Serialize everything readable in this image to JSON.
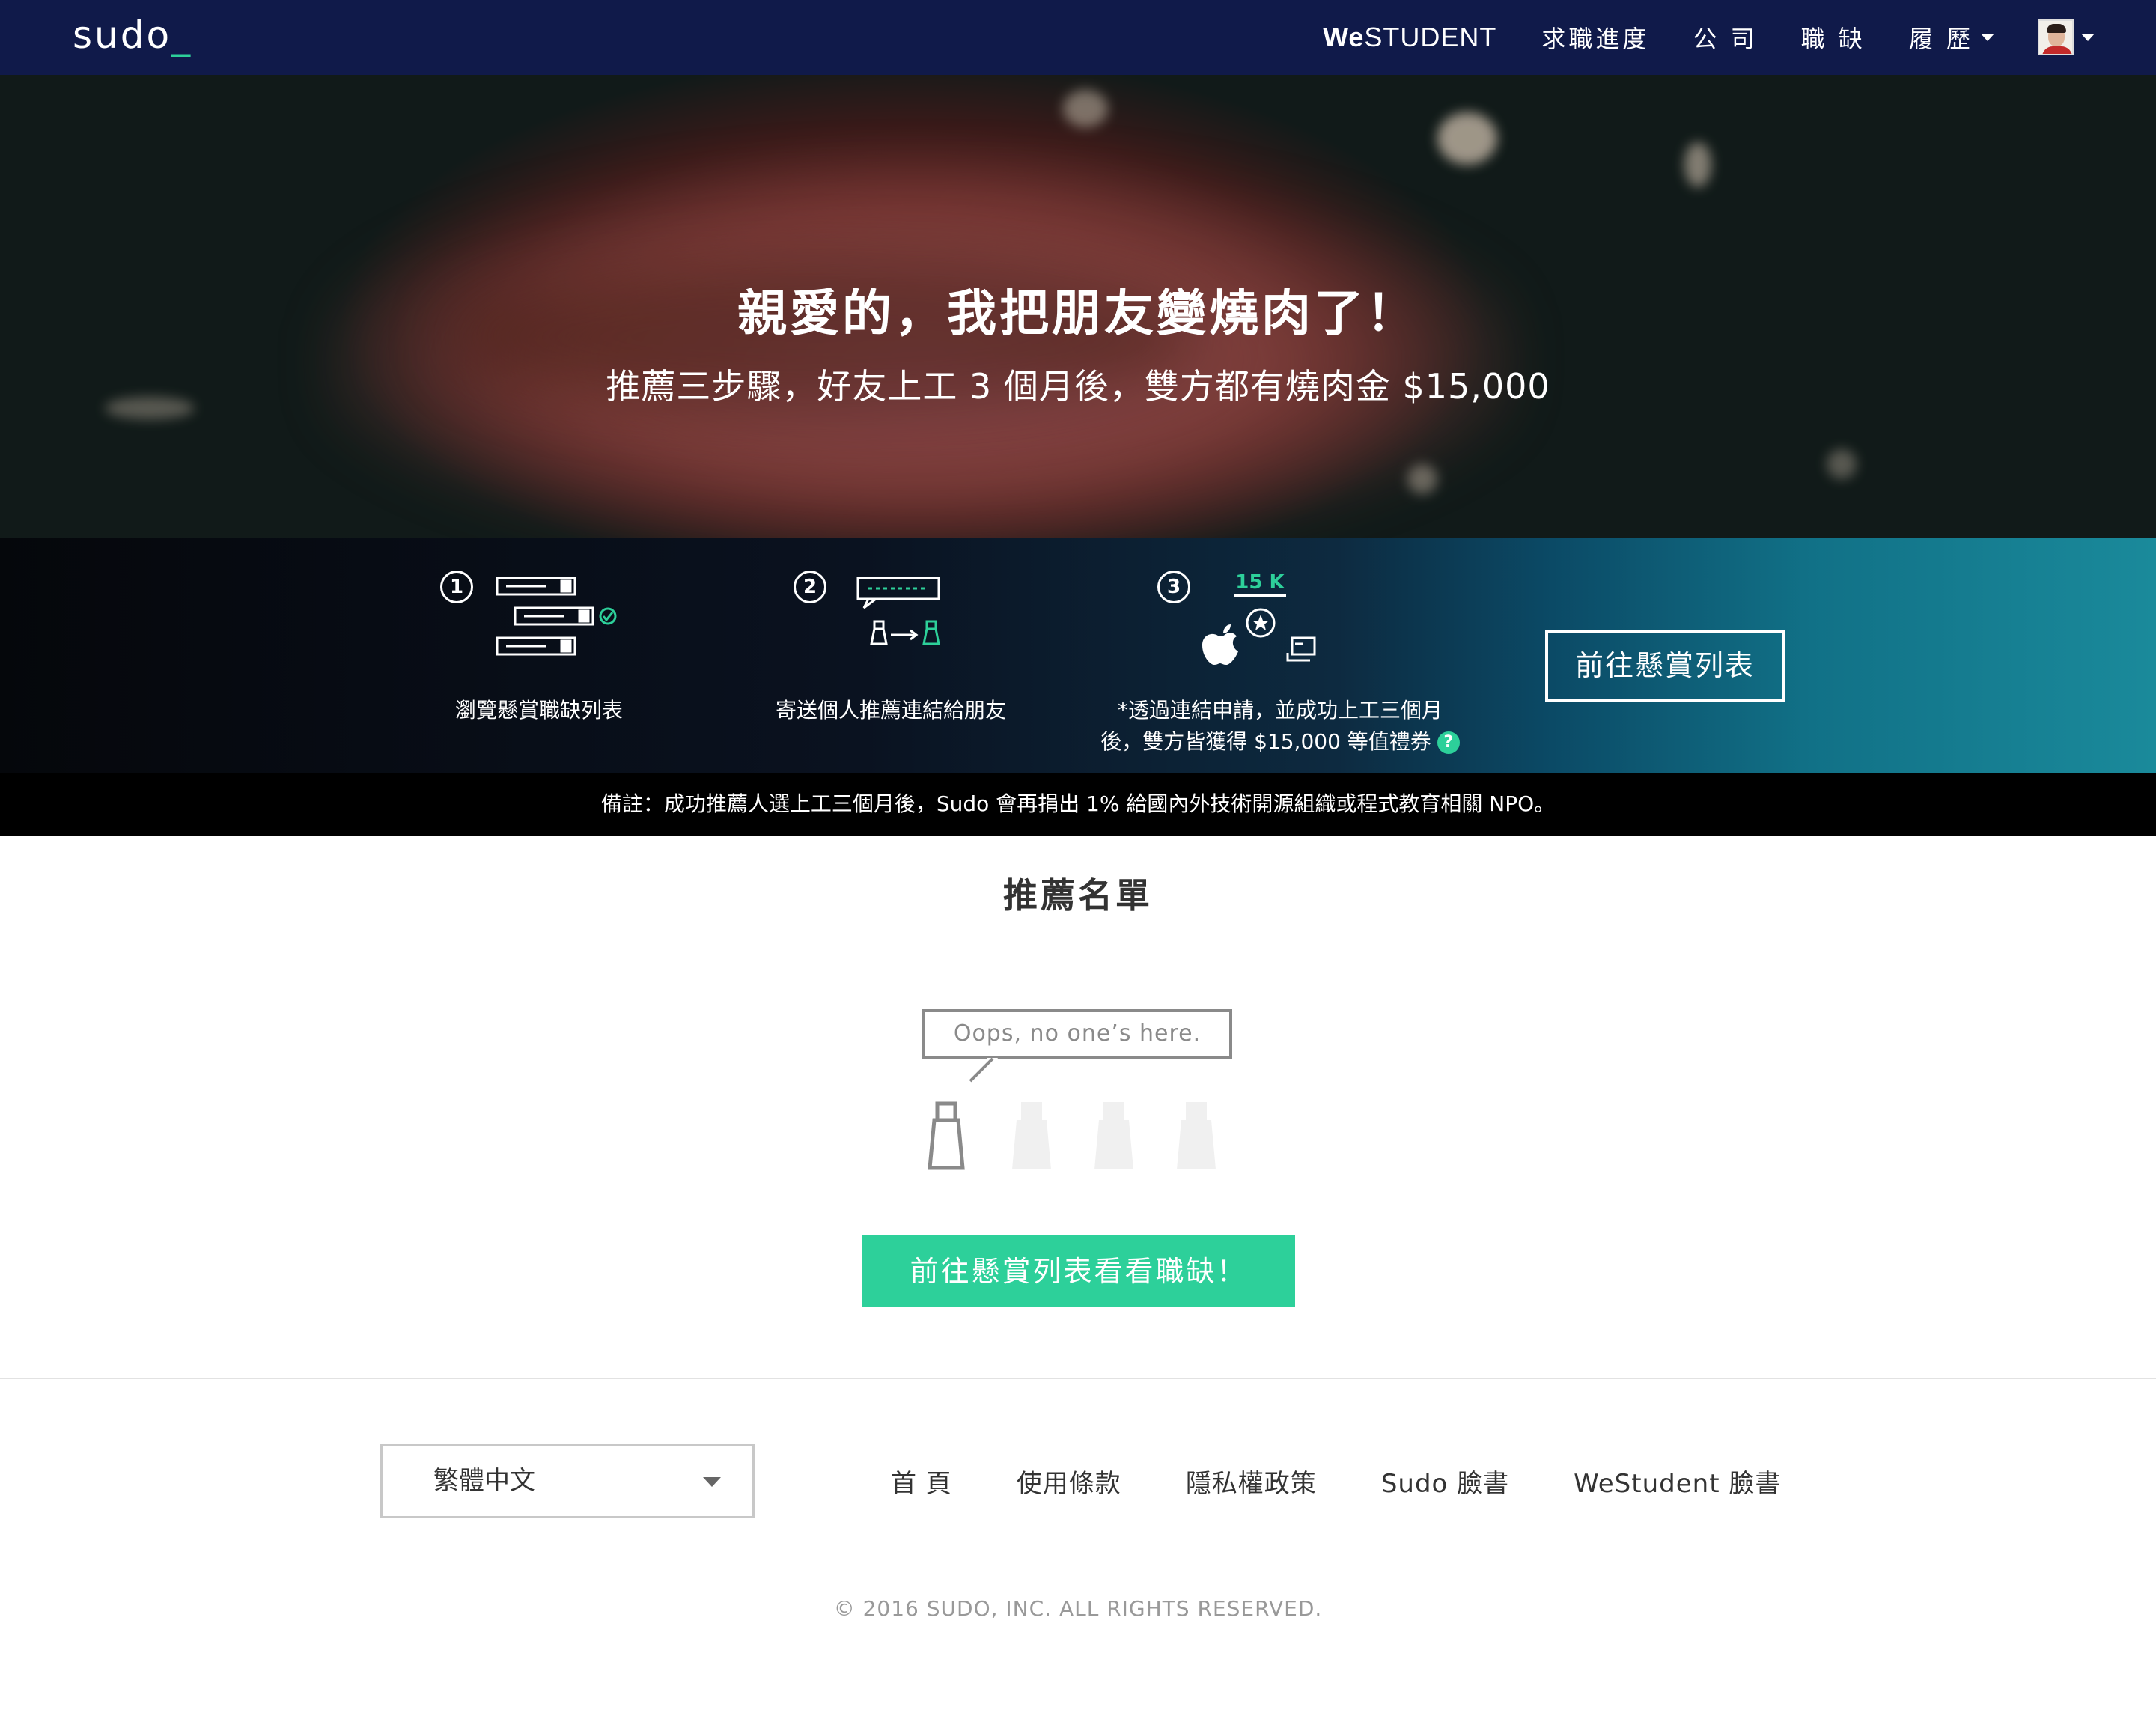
{
  "navbar": {
    "logo": "sudo",
    "logo_cursor": "_",
    "westudent_bold": "We",
    "westudent_rest": "STUDENT",
    "links": [
      "求職進度",
      "公 司",
      "職 缺",
      "履 歷"
    ]
  },
  "hero": {
    "title": "親愛的，我把朋友變燒肉了！",
    "subtitle": "推薦三步驟，好友上工 3 個月後，雙方都有燒肉金 $15,000"
  },
  "steps": [
    {
      "number": "1",
      "label": "瀏覽懸賞職缺列表"
    },
    {
      "number": "2",
      "label": "寄送個人推薦連結給朋友"
    },
    {
      "number": "3",
      "label_line1": "*透過連結申請，並成功上工三個月",
      "label_line2": "後，雙方皆獲得 $15,000 等值禮券",
      "badge": "15 K",
      "help": "?"
    }
  ],
  "steps_cta": "前往懸賞列表",
  "note": "備註：成功推薦人選上工三個月後，Sudo 會再捐出 1% 給國內外技術開源組織或程式教育相關 NPO。",
  "main": {
    "section_title": "推薦名單",
    "empty_message": "Oops, no one’s here.",
    "cta": "前往懸賞列表看看職缺！"
  },
  "footer": {
    "language": "繁體中文",
    "links": [
      "首 頁",
      "使用條款",
      "隱私權政策",
      "Sudo 臉書",
      "WeStudent 臉書"
    ],
    "copyright": "© 2016 SUDO, INC. ALL RIGHTS RESERVED."
  },
  "colors": {
    "navbar": "#101a4a",
    "accent_green": "#2dd09a",
    "note_bar": "#000000"
  },
  "icons": [
    "check-circle-icon",
    "apple-icon",
    "star-circle-icon",
    "gift-card-icon",
    "question-icon",
    "chevron-down-icon"
  ]
}
